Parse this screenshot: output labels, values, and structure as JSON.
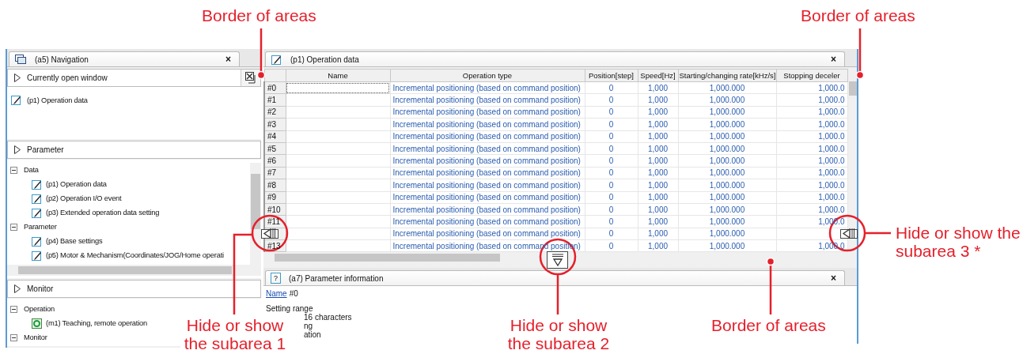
{
  "navigation": {
    "title": "(a5) Navigation",
    "close": "×",
    "sections": [
      {
        "header": "Currently open window",
        "items": [
          {
            "label": "(p1) Operation data",
            "kind": "edit"
          }
        ]
      },
      {
        "header": "Parameter",
        "tree": [
          {
            "label": "Data",
            "expanded": true,
            "children": [
              {
                "label": "(p1) Operation data",
                "kind": "edit"
              },
              {
                "label": "(p2) Operation I/O event",
                "kind": "edit"
              },
              {
                "label": "(p3) Extended operation data setting",
                "kind": "edit"
              }
            ]
          },
          {
            "label": "Parameter",
            "expanded": true,
            "children": [
              {
                "label": "(p4) Base settings",
                "kind": "edit"
              },
              {
                "label": "(p5) Motor & Mechanism(Coordinates/JOG/Home operati",
                "kind": "edit"
              }
            ]
          }
        ]
      },
      {
        "header": "Monitor",
        "tree": [
          {
            "label": "Operation",
            "expanded": true,
            "children": [
              {
                "label": "(m1) Teaching, remote operation",
                "kind": "monitor"
              }
            ]
          },
          {
            "label": "Monitor",
            "expanded": true
          }
        ]
      }
    ]
  },
  "operation_data": {
    "title": "(p1) Operation data",
    "close": "×",
    "table": {
      "columns": [
        "Name",
        "Operation type",
        "Position[step]",
        "Speed[Hz]",
        "Starting/changing rate[kHz/s]",
        "Stopping deceler"
      ],
      "rows": [
        {
          "id": "#0",
          "selected": true,
          "cells": [
            "",
            "Incremental positioning (based on command position)",
            "0",
            "1,000",
            "1,000.000",
            "1,000.0"
          ]
        },
        {
          "id": "#1",
          "selected": false,
          "cells": [
            "",
            "Incremental positioning (based on command position)",
            "0",
            "1,000",
            "1,000.000",
            "1,000.0"
          ]
        },
        {
          "id": "#2",
          "selected": false,
          "cells": [
            "",
            "Incremental positioning (based on command position)",
            "0",
            "1,000",
            "1,000.000",
            "1,000.0"
          ]
        },
        {
          "id": "#3",
          "selected": false,
          "cells": [
            "",
            "Incremental positioning (based on command position)",
            "0",
            "1,000",
            "1,000.000",
            "1,000.0"
          ]
        },
        {
          "id": "#4",
          "selected": false,
          "cells": [
            "",
            "Incremental positioning (based on command position)",
            "0",
            "1,000",
            "1,000.000",
            "1,000.0"
          ]
        },
        {
          "id": "#5",
          "selected": false,
          "cells": [
            "",
            "Incremental positioning (based on command position)",
            "0",
            "1,000",
            "1,000.000",
            "1,000.0"
          ]
        },
        {
          "id": "#6",
          "selected": false,
          "cells": [
            "",
            "Incremental positioning (based on command position)",
            "0",
            "1,000",
            "1,000.000",
            "1,000.0"
          ]
        },
        {
          "id": "#7",
          "selected": false,
          "cells": [
            "",
            "Incremental positioning (based on command position)",
            "0",
            "1,000",
            "1,000.000",
            "1,000.0"
          ]
        },
        {
          "id": "#8",
          "selected": false,
          "cells": [
            "",
            "Incremental positioning (based on command position)",
            "0",
            "1,000",
            "1,000.000",
            "1,000.0"
          ]
        },
        {
          "id": "#9",
          "selected": false,
          "cells": [
            "",
            "Incremental positioning (based on command position)",
            "0",
            "1,000",
            "1,000.000",
            "1,000.0"
          ]
        },
        {
          "id": "#10",
          "selected": false,
          "cells": [
            "",
            "Incremental positioning (based on command position)",
            "0",
            "1,000",
            "1,000.000",
            "1,000.0"
          ]
        },
        {
          "id": "#11",
          "selected": false,
          "cells": [
            "",
            "Incremental positioning (based on command position)",
            "0",
            "1,000",
            "1,000.000",
            "1,000.0"
          ]
        },
        {
          "selected": false,
          "cells": [
            "",
            "Incremental positioning (based on command position)",
            "0",
            "1,000",
            "1,000.000"
          ]
        },
        {
          "id": "#13",
          "selected": false,
          "cells": [
            "",
            "Incremental positioning (based on command position)",
            "0",
            "1,000",
            "1,000.000",
            "1,000.0"
          ]
        }
      ]
    }
  },
  "parameter_information": {
    "title": "(a7) Parameter information",
    "close": "×",
    "help_glyph": "?",
    "name_link": "Name",
    "name_value": "#0",
    "setting_range": "Setting range",
    "details": [
      "16 characters",
      "ng",
      "ation"
    ]
  },
  "callouts": [
    {
      "text": "Border of areas"
    },
    {
      "text": "Border of areas"
    },
    {
      "text": "Hide or show the subarea 3 *"
    },
    {
      "text": "Hide or show the subarea 1"
    },
    {
      "text": "Hide or show the subarea 2"
    },
    {
      "text": "Border of areas"
    }
  ]
}
